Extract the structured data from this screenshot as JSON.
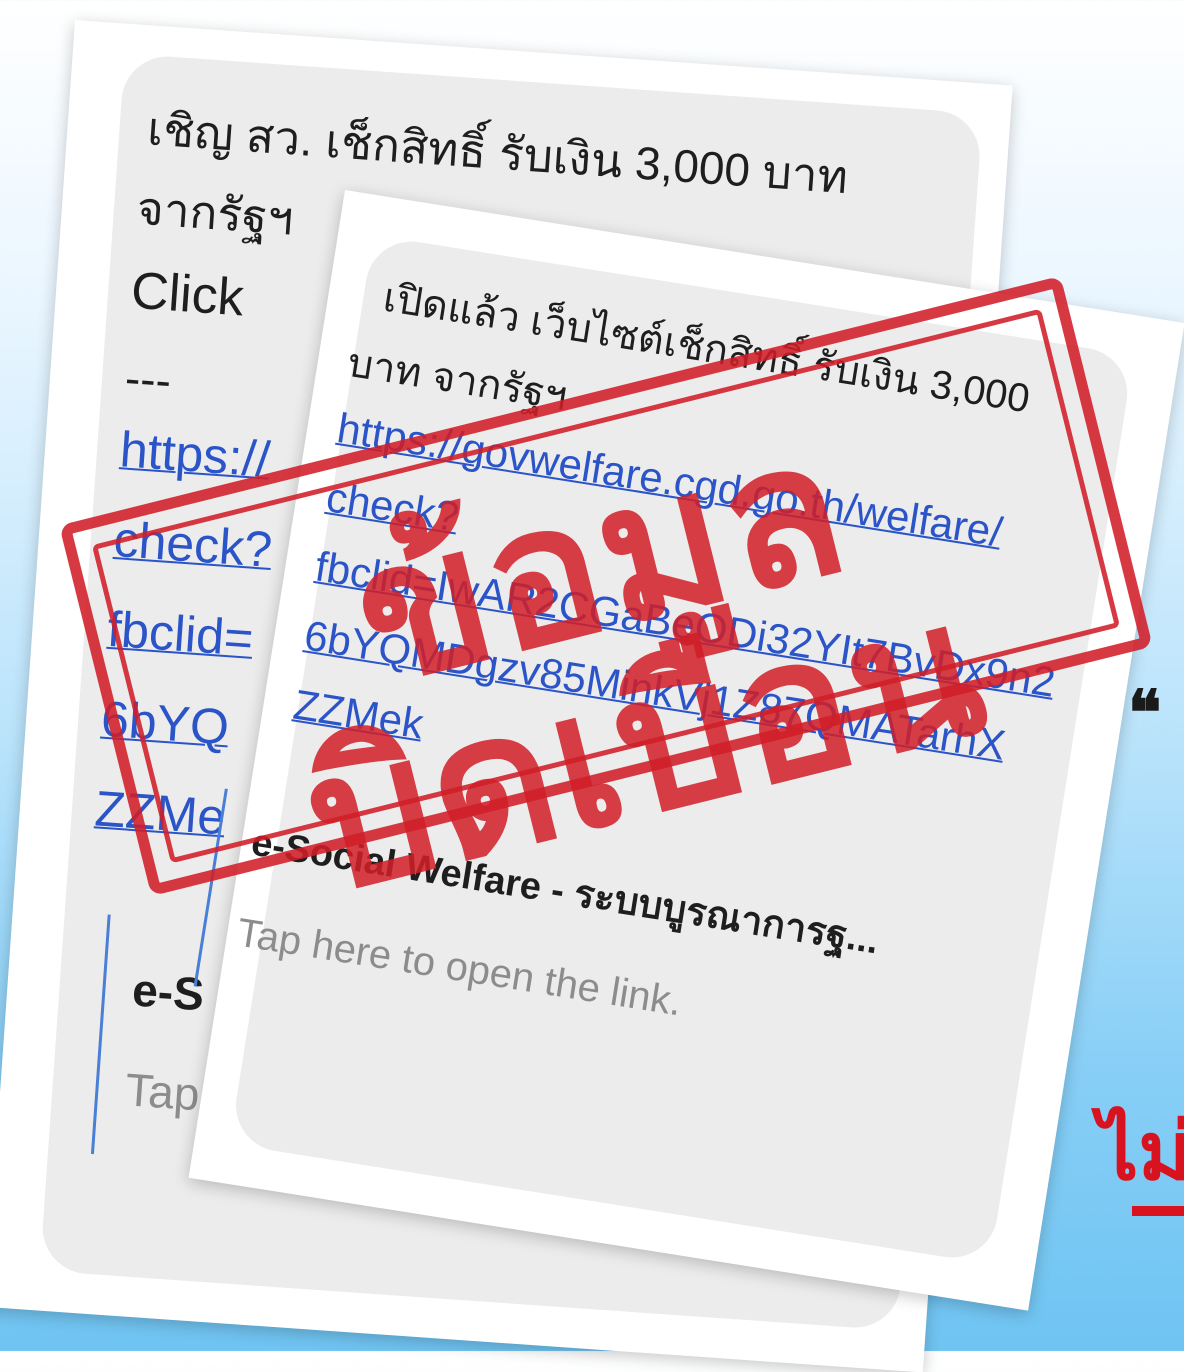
{
  "back_message": {
    "line1": "เชิญ สว. เช็กสิทธิ์ รับเงิน 3,000 บาท",
    "line2": "จากรัฐฯ",
    "line3": "Click",
    "line4": "---",
    "link_lines": [
      "https://",
      "check?",
      "fbclid=",
      "6bYQ",
      "ZZMe"
    ],
    "preview_title": "e-S",
    "preview_sub": "Tap"
  },
  "front_message": {
    "line1": "เปิดแล้ว เว็บไซต์เช็กสิทธิ์ รับเงิน 3,000",
    "line2": "บาท จากรัฐฯ",
    "link_lines": [
      "https://govwelfare.cgd.go.th/welfare/",
      "check?",
      "fbclid=IwAR2CGaBeODi32YIt7BvDx9n2",
      "6bYQMDgzv85MinkVj1Z87QMATarhX",
      "ZZMek"
    ],
    "preview_title": "e-Social Welfare - ระบบบูรณาการฐ...",
    "preview_sub": "Tap here to open the link."
  },
  "stamp": {
    "text": "ข้อมูลบิดเบือน",
    "color": "#d11e28"
  },
  "side": {
    "quote_mark": "❝",
    "red_text": "ไม่"
  }
}
